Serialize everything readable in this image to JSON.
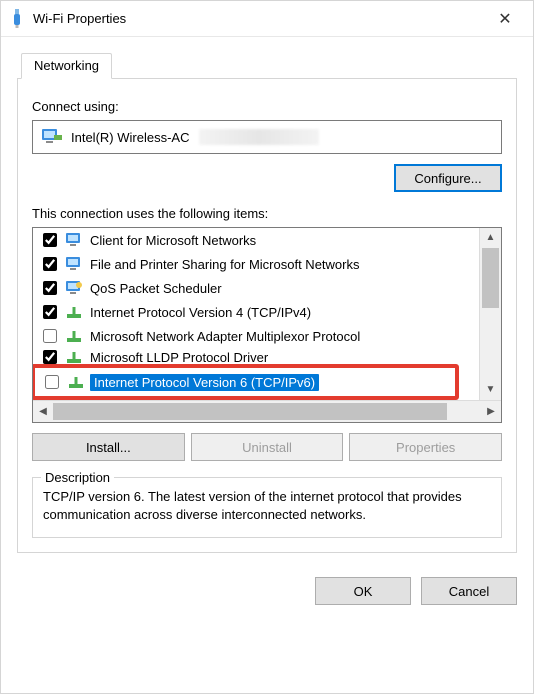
{
  "title": "Wi-Fi Properties",
  "tabs": {
    "networking": "Networking"
  },
  "connect_using_label": "Connect using:",
  "adapter_name": "Intel(R) Wireless-AC",
  "configure_label": "Configure...",
  "items_label": "This connection uses the following items:",
  "items": [
    {
      "label": "Client for Microsoft Networks",
      "checked": true,
      "icon": "monitor"
    },
    {
      "label": "File and Printer Sharing for Microsoft Networks",
      "checked": true,
      "icon": "monitor"
    },
    {
      "label": "QoS Packet Scheduler",
      "checked": true,
      "icon": "monitor"
    },
    {
      "label": "Internet Protocol Version 4 (TCP/IPv4)",
      "checked": true,
      "icon": "protocol"
    },
    {
      "label": "Microsoft Network Adapter Multiplexor Protocol",
      "checked": false,
      "icon": "protocol"
    },
    {
      "label": "Microsoft LLDP Protocol Driver",
      "checked": true,
      "icon": "protocol"
    },
    {
      "label": "Internet Protocol Version 6 (TCP/IPv6)",
      "checked": false,
      "icon": "protocol",
      "selected": true
    }
  ],
  "buttons": {
    "install": "Install...",
    "uninstall": "Uninstall",
    "properties": "Properties"
  },
  "description": {
    "legend": "Description",
    "text": "TCP/IP version 6. The latest version of the internet protocol that provides communication across diverse interconnected networks."
  },
  "footer": {
    "ok": "OK",
    "cancel": "Cancel"
  }
}
